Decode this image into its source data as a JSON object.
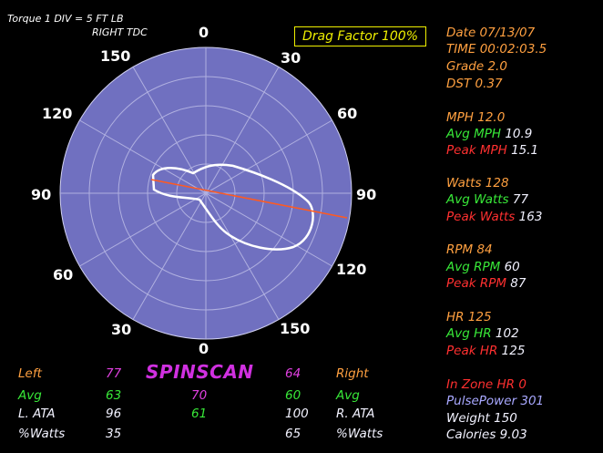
{
  "header": {
    "torque_scale": "Torque  1 DIV = 5 FT LB",
    "tdc_side": "RIGHT TDC",
    "drag_factor": "Drag Factor 100%"
  },
  "polar": {
    "top_label": "0",
    "bottom_label": "0",
    "left_labels": [
      "150",
      "120",
      "90",
      "60",
      "30"
    ],
    "right_labels": [
      "30",
      "60",
      "90",
      "120",
      "150"
    ]
  },
  "stats": {
    "date": "Date 07/13/07",
    "time": "TIME 00:02:03.5",
    "grade": "Grade 2.0",
    "dst": "DST 0.37",
    "mph": "MPH 12.0",
    "avg_mph_label": "Avg MPH",
    "avg_mph": "10.9",
    "peak_mph_label": "Peak MPH",
    "peak_mph": "15.1",
    "watts": "Watts 128",
    "avg_watts_label": "Avg Watts",
    "avg_watts": "77",
    "peak_watts_label": "Peak Watts",
    "peak_watts": "163",
    "rpm": "RPM 84",
    "avg_rpm_label": "Avg RPM",
    "avg_rpm": "60",
    "peak_rpm_label": "Peak RPM",
    "peak_rpm": "87",
    "hr": "HR 125",
    "avg_hr_label": "Avg HR",
    "avg_hr": "102",
    "peak_hr_label": "Peak HR",
    "peak_hr": "125",
    "in_zone_hr": "In Zone HR  0",
    "pulse_power": "PulsePower 301",
    "weight": "Weight 150",
    "calories": "Calories 9.03"
  },
  "spinscan": {
    "title": "SPINSCAN",
    "left_label": "Left",
    "left_value": "77",
    "right_value": "64",
    "right_label": "Right",
    "avg_label_left": "Avg",
    "avg_left": "63",
    "avg_center": "70",
    "avg_right": "60",
    "avg_label_right": "Avg",
    "ata_label_left": "L. ATA",
    "ata_left": "96",
    "ata_center": "61",
    "ata_right": "100",
    "ata_label_right": "R. ATA",
    "watts_label_left": "%Watts",
    "watts_left": "35",
    "watts_right": "65",
    "watts_label_right": "%Watts"
  },
  "colors": {
    "polar_fill": "#7070c0",
    "grid": "#b0b0e0",
    "orange": "#ffa040",
    "green": "#38e838",
    "red": "#ff3030",
    "magenta": "#d030e0",
    "drag_box": "#f0f000"
  }
}
